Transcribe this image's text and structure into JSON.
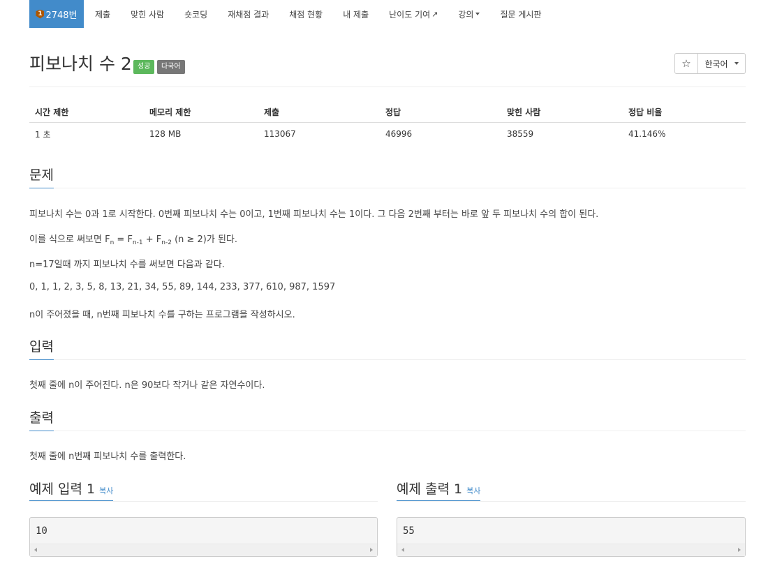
{
  "nav": {
    "problem_number": "2748번",
    "tier_icon": "1",
    "items": [
      "제출",
      "맞힌 사람",
      "숏코딩",
      "재채점 결과",
      "채점 현황",
      "내 제출",
      "난이도 기여",
      "강의",
      "질문 게시판"
    ]
  },
  "title": {
    "text": "피보나치 수 2",
    "badge_success": "성공",
    "badge_multi": "다국어",
    "star": "☆",
    "language": "한국어"
  },
  "info": {
    "headers": [
      "시간 제한",
      "메모리 제한",
      "제출",
      "정답",
      "맞힌 사람",
      "정답 비율"
    ],
    "values": [
      "1 초",
      "128 MB",
      "113067",
      "46996",
      "38559",
      "41.146%"
    ]
  },
  "problem": {
    "heading": "문제",
    "p1": "피보나치 수는 0과 1로 시작한다. 0번째 피보나치 수는 0이고, 1번째 피보나치 수는 1이다. 그 다음 2번째 부터는 바로 앞 두 피보나치 수의 합이 된다.",
    "p2_prefix": "이를 식으로 써보면 F",
    "p2_sub1": "n",
    "p2_mid1": " = F",
    "p2_sub2": "n-1",
    "p2_mid2": " + F",
    "p2_sub3": "n-2",
    "p2_suffix": " (n ≥ 2)가 된다.",
    "p3": "n=17일때 까지 피보나치 수를 써보면 다음과 같다.",
    "p4": "0, 1, 1, 2, 3, 5, 8, 13, 21, 34, 55, 89, 144, 233, 377, 610, 987, 1597",
    "p5": "n이 주어졌을 때, n번째 피보나치 수를 구하는 프로그램을 작성하시오."
  },
  "input": {
    "heading": "입력",
    "text": "첫째 줄에 n이 주어진다. n은 90보다 작거나 같은 자연수이다."
  },
  "output": {
    "heading": "출력",
    "text": "첫째 줄에 n번째 피보나치 수를 출력한다."
  },
  "samples": {
    "input_heading": "예제 입력 1",
    "output_heading": "예제 출력 1",
    "copy_label": "복사",
    "input_value": "10",
    "output_value": "55"
  },
  "colors": {
    "primary": "#428bca",
    "success": "#5cb85c",
    "muted": "#777777",
    "tier": "#ad5600"
  }
}
